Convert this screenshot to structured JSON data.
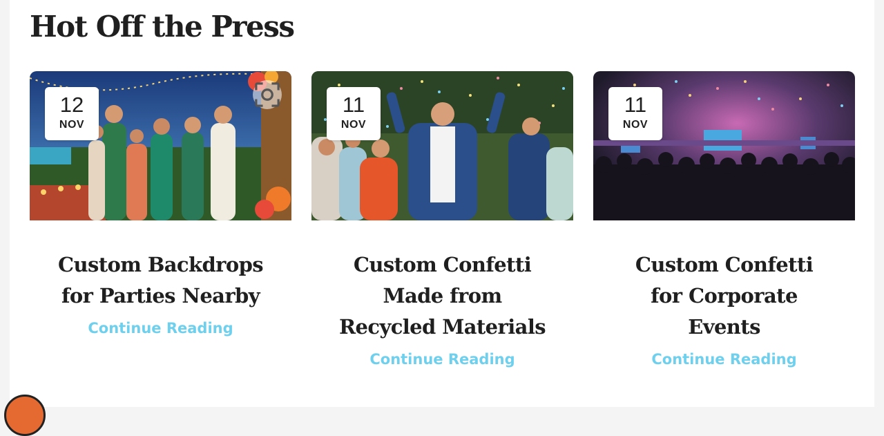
{
  "section": {
    "title": "Hot Off the Press"
  },
  "posts": [
    {
      "day": "12",
      "month": "NOV",
      "title": "Custom Backdrops for Parties Nearby",
      "link": "Continue Reading",
      "image_icon": "tropical-party-photo"
    },
    {
      "day": "11",
      "month": "NOV",
      "title": "Custom Confetti Made from Recycled Materials",
      "link": "Continue Reading",
      "image_icon": "confetti-celebration-photo"
    },
    {
      "day": "11",
      "month": "NOV",
      "title": "Custom Confetti for Corporate Events",
      "link": "Continue Reading",
      "image_icon": "corporate-event-photo"
    }
  ],
  "colors": {
    "link": "#6fd0ee",
    "heading": "#1f1f1f",
    "scroll_button": "#e46a32"
  }
}
